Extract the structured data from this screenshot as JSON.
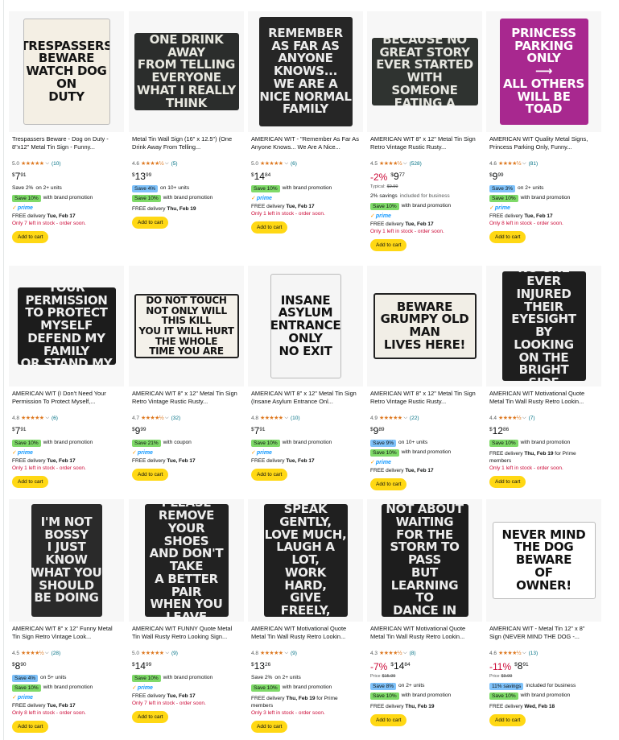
{
  "products": [
    {
      "title": "Trespassers Beware - Dog on Duty - 8\"x12\" Metal Tin Sign - Funny...",
      "rating": "5.0",
      "stars": "★★★★★",
      "reviews": "(10)",
      "price_symbol": "$",
      "price_whole": "7",
      "price_frac": "91",
      "discount": "",
      "typical_label": "",
      "typical_price": "",
      "offers": [
        {
          "kind": "text",
          "label": "Save 2%",
          "text": "on 2+ units"
        },
        {
          "kind": "green",
          "label": "Save 10%",
          "text": "with brand promotion"
        }
      ],
      "prime": true,
      "delivery_prefix": "FREE delivery ",
      "delivery_date": "Tue, Feb 17",
      "delivery_suffix": "",
      "stock": "Only 7 left in stock - order soon.",
      "cart": "Add to cart",
      "sign": {
        "bg": "#f4efe4",
        "fg": "#141414",
        "text": "TRESPASSERS\nBEWARE\nWATCH DOG ON\nDUTY",
        "shape": "beware-dog"
      }
    },
    {
      "title": "Metal Tin Wall Sign (16\" x 12.5\") (One Drink Away From Telling...",
      "rating": "4.6",
      "stars": "★★★★½",
      "reviews": "(5)",
      "price_symbol": "$",
      "price_whole": "13",
      "price_frac": "99",
      "discount": "",
      "typical_label": "",
      "typical_price": "",
      "offers": [
        {
          "kind": "blue",
          "label": "Save 4%",
          "text": "on 10+ units"
        },
        {
          "kind": "green",
          "label": "Save 10%",
          "text": "with brand promotion"
        }
      ],
      "prime": false,
      "delivery_prefix": "FREE delivery ",
      "delivery_date": "Thu, Feb 19",
      "delivery_suffix": "",
      "stock": "",
      "cart": "Add to cart",
      "sign": {
        "bg": "#2b2d2c",
        "fg": "#e8e8e0",
        "text": "ONE DRINK AWAY\nFROM TELLING\nEVERYONE\nWHAT I REALLY THINK"
      }
    },
    {
      "title": "AMERICAN WIT - \"Remember As Far As Anyone Knows... We Are A Nice...",
      "rating": "5.0",
      "stars": "★★★★★",
      "reviews": "(6)",
      "price_symbol": "$",
      "price_whole": "14",
      "price_frac": "84",
      "discount": "",
      "typical_label": "",
      "typical_price": "",
      "offers": [
        {
          "kind": "green",
          "label": "Save 10%",
          "text": "with brand promotion"
        }
      ],
      "prime": true,
      "delivery_prefix": "FREE delivery ",
      "delivery_date": "Tue, Feb 17",
      "delivery_suffix": "",
      "stock": "Only 1 left in stock - order soon.",
      "cart": "Add to cart",
      "sign": {
        "bg": "#262626",
        "fg": "#ececec",
        "text": "REMEMBER\nAS FAR AS\nANYONE KNOWS...\nWE ARE A\nNICE NORMAL\nFAMILY"
      }
    },
    {
      "title": "AMERICAN WIT 8\" x 12\" Metal Tin Sign Retro Vintage Rustic Rusty...",
      "rating": "4.5",
      "stars": "★★★★½",
      "reviews": "(528)",
      "price_symbol": "$",
      "price_whole": "9",
      "price_frac": "77",
      "discount": "-2%",
      "typical_label": "Typical:",
      "typical_price": "$9.99",
      "offers": [
        {
          "kind": "plain",
          "label": "2% savings",
          "text": "included for business"
        },
        {
          "kind": "green",
          "label": "Save 10%",
          "text": "with brand promotion"
        }
      ],
      "prime": true,
      "delivery_prefix": "FREE delivery ",
      "delivery_date": "Tue, Feb 17",
      "delivery_suffix": "",
      "stock": "Only 1 left in stock - order soon.",
      "cart": "Add to cart",
      "sign": {
        "bg": "#2f3330",
        "fg": "#e6e6e0",
        "text": "ALCOHOL\nBECAUSE NO GREAT STORY\nEVER STARTED WITH\nSOMEONE EATING A SALAD"
      }
    },
    {
      "title": "AMERICAN WIT Quality Metal Signs, Princess Parking Only, Funny...",
      "rating": "4.6",
      "stars": "★★★★½",
      "reviews": "(81)",
      "price_symbol": "$",
      "price_whole": "9",
      "price_frac": "99",
      "discount": "",
      "typical_label": "",
      "typical_price": "",
      "offers": [
        {
          "kind": "blue",
          "label": "Save 3%",
          "text": "on 2+ units"
        },
        {
          "kind": "green",
          "label": "Save 10%",
          "text": "with brand promotion"
        }
      ],
      "prime": true,
      "delivery_prefix": "FREE delivery ",
      "delivery_date": "Tue, Feb 17",
      "delivery_suffix": "",
      "stock": "Only 8 left in stock - order soon.",
      "cart": "Add to cart",
      "sign": {
        "bg": "#a8288f",
        "fg": "#ffffff",
        "text": "PRINCESS\nPARKING\nONLY\n⟶\nALL OTHERS\nWILL BE\nTOAD"
      }
    },
    {
      "title": "AMERICAN WIT (I Don't Need Your Permission To Protect Myself,...",
      "rating": "4.8",
      "stars": "★★★★★",
      "reviews": "(6)",
      "price_symbol": "$",
      "price_whole": "7",
      "price_frac": "91",
      "discount": "",
      "typical_label": "",
      "typical_price": "",
      "offers": [
        {
          "kind": "green",
          "label": "Save 10%",
          "text": "with brand promotion"
        }
      ],
      "prime": true,
      "delivery_prefix": "FREE delivery ",
      "delivery_date": "Tue, Feb 17",
      "delivery_suffix": "",
      "stock": "Only 1 left in stock - order soon.",
      "cart": "Add to cart",
      "sign": {
        "bg": "#1c1c1c",
        "fg": "#f0f0f0",
        "text": "I DON'T NEED\nYOUR PERMISSION\nTO PROTECT MYSELF\nDEFEND MY FAMILY\nOR STAND MY GROUND"
      }
    },
    {
      "title": "AMERICAN WIT 8\" x 12\" Metal Tin Sign Retro Vintage Rustic Rusty...",
      "rating": "4.7",
      "stars": "★★★★½",
      "reviews": "(32)",
      "price_symbol": "$",
      "price_whole": "9",
      "price_frac": "99",
      "discount": "",
      "typical_label": "",
      "typical_price": "",
      "offers": [
        {
          "kind": "green",
          "label": "Save 21%",
          "text": "with coupon"
        }
      ],
      "prime": true,
      "delivery_prefix": "FREE delivery ",
      "delivery_date": "Tue, Feb 17",
      "delivery_suffix": "",
      "stock": "",
      "cart": "Add to cart",
      "sign": {
        "bg": "#f4f1ea",
        "fg": "#141414",
        "text": "DANGER\nDO NOT TOUCH\nNOT ONLY WILL THIS KILL\nYOU IT WILL HURT THE WHOLE\nTIME YOU ARE DYING",
        "shape": "danger"
      }
    },
    {
      "title": "AMERICAN WIT 8\" x 12\" Metal Tin Sign (Insane Asylum Entrance Onl...",
      "rating": "4.8",
      "stars": "★★★★★",
      "reviews": "(10)",
      "price_symbol": "$",
      "price_whole": "7",
      "price_frac": "91",
      "discount": "",
      "typical_label": "",
      "typical_price": "",
      "offers": [
        {
          "kind": "green",
          "label": "Save 10%",
          "text": "with brand promotion"
        }
      ],
      "prime": true,
      "delivery_prefix": "FREE delivery ",
      "delivery_date": "Tue, Feb 17",
      "delivery_suffix": "",
      "stock": "",
      "cart": "Add to cart",
      "sign": {
        "bg": "#f5f5f5",
        "fg": "#111111",
        "text": "INSANE\nASYLUM\nENTRANCE\nONLY\nNO EXIT",
        "shape": "noexit"
      }
    },
    {
      "title": "AMERICAN WIT 8\" x 12\" Metal Tin Sign Retro Vintage Rustic Rusty...",
      "rating": "4.9",
      "stars": "★★★★★",
      "reviews": "(22)",
      "price_symbol": "$",
      "price_whole": "9",
      "price_frac": "89",
      "discount": "",
      "typical_label": "",
      "typical_price": "",
      "offers": [
        {
          "kind": "blue",
          "label": "Save 9%",
          "text": "on 10+ units"
        },
        {
          "kind": "green",
          "label": "Save 10%",
          "text": "with brand promotion"
        }
      ],
      "prime": true,
      "delivery_prefix": "FREE delivery ",
      "delivery_date": "Tue, Feb 17",
      "delivery_suffix": "",
      "stock": "",
      "cart": "Add to cart",
      "sign": {
        "bg": "#f1eee6",
        "fg": "#151515",
        "text": "BEWARE\nGRUMPY OLD MAN\nLIVES HERE!",
        "shape": "beware"
      }
    },
    {
      "title": "AMERICAN WIT Motivational Quote Metal Tin Wall Rusty Retro Lookin...",
      "rating": "4.4",
      "stars": "★★★★½",
      "reviews": "(7)",
      "price_symbol": "$",
      "price_whole": "12",
      "price_frac": "86",
      "discount": "",
      "typical_label": "",
      "typical_price": "",
      "offers": [
        {
          "kind": "green",
          "label": "Save 10%",
          "text": "with brand promotion"
        }
      ],
      "prime": false,
      "delivery_prefix": "FREE delivery ",
      "delivery_date": "Thu, Feb 19",
      "delivery_suffix": " for Prime members",
      "stock": "Only 1 left in stock - order soon.",
      "cart": "Add to cart",
      "sign": {
        "bg": "#1e1e1e",
        "fg": "#ededed",
        "text": "NO ONE EVER\nINJURED THEIR\nEYESIGHT BY\nLOOKING ON THE\nBRIGHT SIDE"
      }
    },
    {
      "title": "AMERICAN WIT 8\" x 12\" Funny Metal Tin Sign Retro Vintage Look...",
      "rating": "4.5",
      "stars": "★★★★½",
      "reviews": "(28)",
      "price_symbol": "$",
      "price_whole": "8",
      "price_frac": "90",
      "discount": "",
      "typical_label": "",
      "typical_price": "",
      "offers": [
        {
          "kind": "blue",
          "label": "Save 4%",
          "text": "on 5+ units"
        },
        {
          "kind": "green",
          "label": "Save 10%",
          "text": "with brand promotion"
        }
      ],
      "prime": true,
      "delivery_prefix": "FREE delivery ",
      "delivery_date": "Tue, Feb 17",
      "delivery_suffix": "",
      "stock": "Only 8 left in stock - order soon.",
      "cart": "Add to cart",
      "sign": {
        "bg": "#2a2a2a",
        "fg": "#ededed",
        "text": "I'M NOT\nBOSSY\nI JUST KNOW\nWHAT YOU\nSHOULD BE DOING"
      }
    },
    {
      "title": "AMERICAN WIT FUNNY Quote Metal Tin Wall Rusty Retro Looking Sign...",
      "rating": "5.0",
      "stars": "★★★★★",
      "reviews": "(9)",
      "price_symbol": "$",
      "price_whole": "14",
      "price_frac": "99",
      "discount": "",
      "typical_label": "",
      "typical_price": "",
      "offers": [
        {
          "kind": "green",
          "label": "Save 10%",
          "text": "with brand promotion"
        }
      ],
      "prime": true,
      "delivery_prefix": "FREE delivery ",
      "delivery_date": "Tue, Feb 17",
      "delivery_suffix": "",
      "stock": "Only 7 left in stock - order soon.",
      "cart": "Add to cart",
      "sign": {
        "bg": "#222222",
        "fg": "#ededed",
        "text": "PLEASE REMOVE\nYOUR SHOES\nAND DON'T TAKE\nA BETTER PAIR\nWHEN YOU LEAVE"
      }
    },
    {
      "title": "AMERICAN WIT Motivational Quote Metal Tin Wall Rusty Retro Lookin...",
      "rating": "4.8",
      "stars": "★★★★★",
      "reviews": "(9)",
      "price_symbol": "$",
      "price_whole": "13",
      "price_frac": "26",
      "discount": "",
      "typical_label": "",
      "typical_price": "",
      "offers": [
        {
          "kind": "text",
          "label": "Save 2%",
          "text": "on 2+ units"
        },
        {
          "kind": "green",
          "label": "Save 10%",
          "text": "with brand promotion"
        }
      ],
      "prime": false,
      "delivery_prefix": "FREE delivery ",
      "delivery_date": "Thu, Feb 19",
      "delivery_suffix": " for Prime members",
      "stock": "Only 3 left in stock - order soon.",
      "cart": "Add to cart",
      "sign": {
        "bg": "#202020",
        "fg": "#ededed",
        "text": "THINK DEEPLY,\nSPEAK GENTLY,\nLOVE MUCH,\nLAUGH A LOT,\nWORK HARD,\nGIVE FREELY,\nAND BE KIND!"
      }
    },
    {
      "title": "AMERICAN WIT Motivational Quote Metal Tin Wall Rusty Retro Lookin...",
      "rating": "4.3",
      "stars": "★★★★½",
      "reviews": "(8)",
      "price_symbol": "$",
      "price_whole": "14",
      "price_frac": "84",
      "discount": "-7%",
      "typical_label": "Price",
      "typical_price": "$15.99",
      "offers": [
        {
          "kind": "blue",
          "label": "Save 8%",
          "text": "on 2+ units"
        },
        {
          "kind": "green",
          "label": "Save 10%",
          "text": "with brand promotion"
        }
      ],
      "prime": false,
      "delivery_prefix": "FREE delivery ",
      "delivery_date": "Thu, Feb 19",
      "delivery_suffix": "",
      "stock": "",
      "cart": "Add to cart",
      "sign": {
        "bg": "#1d1d1d",
        "fg": "#ededed",
        "text": "LIFE IS\nNOT ABOUT\nWAITING FOR THE\nSTORM TO PASS\nBUT LEARNING TO\nDANCE IN\nTHE RAIN"
      }
    },
    {
      "title": "AMERICAN WIT - Metal Tin 12\" x 8\" Sign (NEVER MIND THE DOG -...",
      "rating": "4.6",
      "stars": "★★★★½",
      "reviews": "(13)",
      "price_symbol": "$",
      "price_whole": "8",
      "price_frac": "91",
      "discount": "-11%",
      "typical_label": "Price",
      "typical_price": "$9.99",
      "offers": [
        {
          "kind": "blue",
          "label": "11% savings",
          "text": "included for business"
        },
        {
          "kind": "green",
          "label": "Save 10%",
          "text": "with brand promotion"
        }
      ],
      "prime": false,
      "delivery_prefix": "FREE delivery ",
      "delivery_date": "Wed, Feb 18",
      "delivery_suffix": "",
      "stock": "",
      "cart": "Add to cart",
      "sign": {
        "bg": "#ffffff",
        "fg": "#111111",
        "text": "NEVER MIND\nTHE DOG\nBEWARE\nOF\nOWNER!",
        "shape": "nevermind"
      }
    }
  ]
}
